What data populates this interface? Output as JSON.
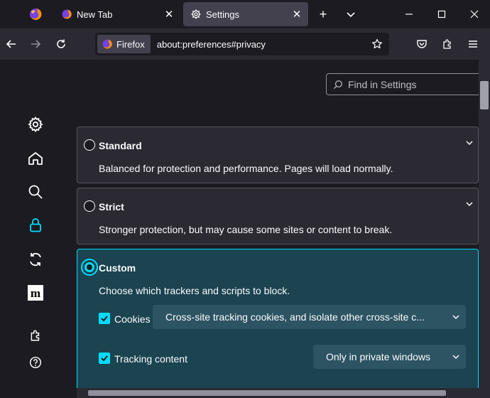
{
  "tabstrip": {
    "tabs": [
      {
        "label": "New Tab",
        "icon": "firefox-icon"
      },
      {
        "label": "Settings",
        "icon": "gear-icon",
        "active": true
      }
    ],
    "close_glyph": "✕",
    "new_tab_glyph": "+"
  },
  "navbar": {
    "identity_label": "Firefox",
    "url": "about:preferences#privacy"
  },
  "search": {
    "placeholder": "Find in Settings"
  },
  "tracking_options": [
    {
      "title": "Standard",
      "description": "Balanced for protection and performance. Pages will load normally.",
      "selected": false
    },
    {
      "title": "Strict",
      "description": "Stronger protection, but may cause some sites or content to break.",
      "selected": false
    },
    {
      "title": "Custom",
      "description": "Choose which trackers and scripts to block.",
      "selected": true
    }
  ],
  "custom": {
    "cookies": {
      "label": "Cookies",
      "checked": true,
      "select_value": "Cross-site tracking cookies, and isolate other cross-site c..."
    },
    "tracking": {
      "label": "Tracking content",
      "checked": true,
      "select_value": "Only in private windows"
    }
  },
  "colors": {
    "accent": "#00ddff",
    "custom_card_bg": "#1b4350",
    "page_bg": "#1c1b22",
    "toolbar_bg": "#2b2a33"
  }
}
